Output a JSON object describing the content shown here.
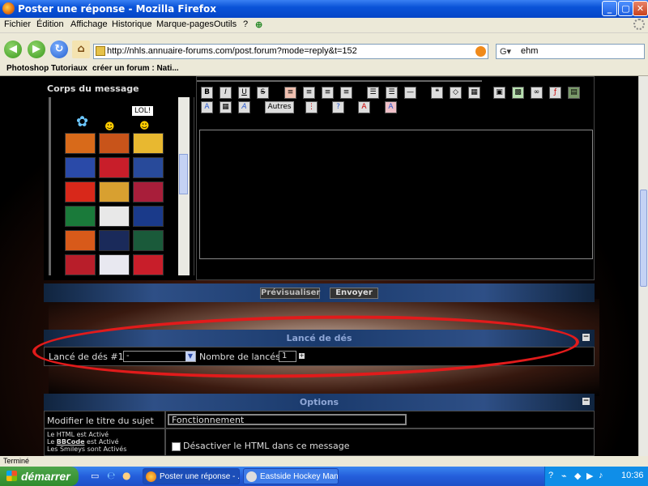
{
  "window": {
    "title": "Poster une réponse - Mozilla Firefox"
  },
  "menu": {
    "items": [
      "Fichier",
      "Édition",
      "Affichage",
      "Historique",
      "Marque-pages",
      "Outils",
      "?"
    ]
  },
  "nav": {
    "url": "http://nhls.annuaire-forums.com/post.forum?mode=reply&t=152",
    "search_value": "ehm"
  },
  "bookmarks": {
    "items": [
      "Photoshop Tutoriaux",
      "créer un forum : Nati..."
    ]
  },
  "smileys": {
    "header": "Corps du message",
    "tooltip": "LOL!"
  },
  "toolbar": {
    "autres_label": "Autres"
  },
  "actions": {
    "preview_label": "Prévisualiser",
    "send_label": "Envoyer"
  },
  "dice": {
    "section_title": "Lancé de dés",
    "dice_label": "Lancé de dés #1 :",
    "dice_value": "-",
    "count_label": "Nombre de lancés :",
    "count_value": "1"
  },
  "options": {
    "section_title": "Options",
    "title_label": "Modifier le titre du sujet",
    "title_value": "Fonctionnement",
    "html_status": "Le HTML est Activé",
    "bbcode_status_prefix": "Le ",
    "bbcode_link": "BBCode",
    "bbcode_status_suffix": " est Activé",
    "smileys_status": "Les Smileys sont Activés",
    "disable_html_label": "Désactiver le HTML dans ce message"
  },
  "statusbar": {
    "text": "Terminé"
  },
  "taskbar": {
    "start_label": "démarrer",
    "items": [
      "Poster une réponse - ...",
      "Eastside Hockey Man..."
    ],
    "clock": "10:36"
  },
  "colors": {
    "highlight_ring": "#e11b1b",
    "panel_band": "#2e4f86"
  }
}
